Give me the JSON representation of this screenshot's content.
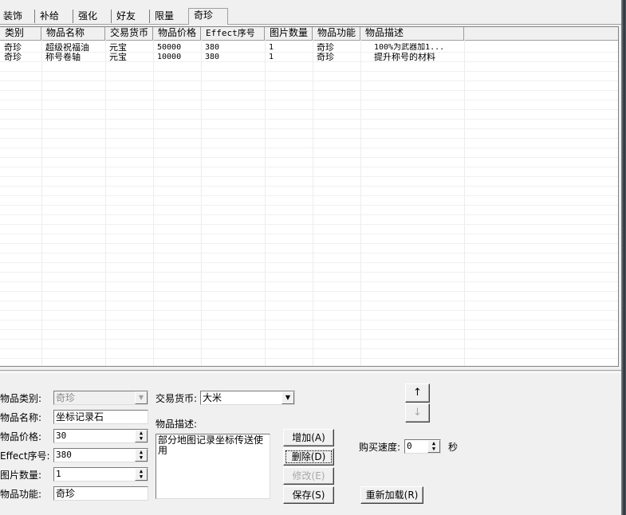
{
  "tabs": [
    {
      "label": "装饰"
    },
    {
      "label": "补给"
    },
    {
      "label": "强化"
    },
    {
      "label": "好友"
    },
    {
      "label": "限量"
    },
    {
      "label": "奇珍"
    }
  ],
  "table": {
    "columns": [
      "类别",
      "物品名称",
      "交易货币",
      "物品价格",
      "Effect序号",
      "图片数量",
      "物品功能",
      "物品描述"
    ],
    "rows": [
      [
        "奇珍",
        "超级祝福油",
        "元宝",
        "50000",
        "380",
        "1",
        "奇珍",
        "100%为武器加1..."
      ],
      [
        "奇珍",
        "称号卷轴",
        "元宝",
        "10000",
        "380",
        "1",
        "奇珍",
        "提升称号的材料"
      ]
    ]
  },
  "form": {
    "category_label": "物品类别:",
    "category_value": "奇珍",
    "name_label": "物品名称:",
    "name_value": "坐标记录石",
    "price_label": "物品价格:",
    "price_value": "30",
    "effect_label": "Effect序号:",
    "effect_value": "380",
    "image_count_label": "图片数量:",
    "image_count_value": "1",
    "function_label": "物品功能:",
    "function_value": "奇珍",
    "currency_label": "交易货币:",
    "currency_value": "大米",
    "desc_label": "物品描述:",
    "desc_value": "部分地图记录坐标传送使用",
    "add_button": "增加(A)",
    "delete_button": "删除(D)",
    "modify_button": "修改(E)",
    "save_button": "保存(S)",
    "buy_speed_label": "购买速度:",
    "buy_speed_value": "0",
    "seconds_label": "秒",
    "reload_button": "重新加载(R)",
    "up_arrow": "↑",
    "down_arrow": "↓"
  }
}
